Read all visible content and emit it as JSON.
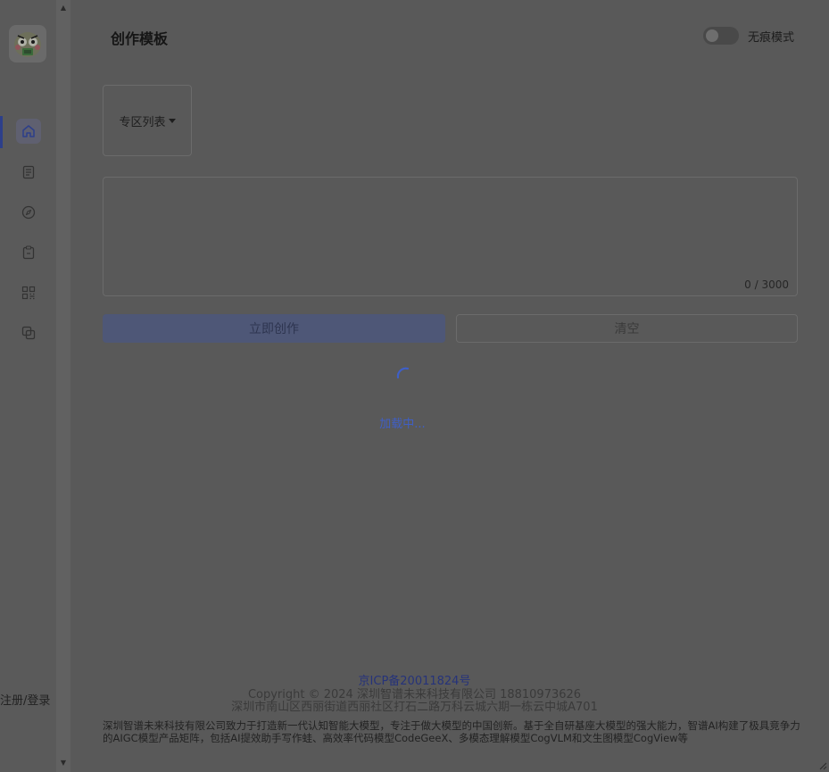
{
  "header": {
    "title": "创作模板",
    "incognito_label": "无痕模式"
  },
  "sidebar": {
    "items": [
      {
        "icon": "home-icon",
        "active": true
      },
      {
        "icon": "document-icon",
        "active": false
      },
      {
        "icon": "compass-icon",
        "active": false
      },
      {
        "icon": "clipboard-icon",
        "active": false
      },
      {
        "icon": "grid-apps-icon",
        "active": false
      },
      {
        "icon": "copy-icon",
        "active": false
      }
    ],
    "login_label": "注册/登录"
  },
  "main": {
    "zone_select_label": "专区列表",
    "textarea": {
      "value": "",
      "counter": "0 / 3000"
    },
    "create_button": "立即创作",
    "clear_button": "清空",
    "loading_text": "加载中..."
  },
  "footer": {
    "icp": "京ICP备20011824号",
    "copyright": "Copyright © 2024 深圳智谱未来科技有限公司 18810973626",
    "address": "深圳市南山区西丽街道西丽社区打石二路万科云城六期一栋云中城A701",
    "description": "深圳智谱未来科技有限公司致力于打造新一代认知智能大模型，专注于做大模型的中国创新。基于全自研基座大模型的强大能力，智谱AI构建了极具竞争力的AIGC模型产品矩阵，包括AI提效助手写作蛙、高效率代码模型CodeGeeX、多模态理解模型CogVLM和文生图模型CogView等"
  },
  "colors": {
    "overlay_bg": "#595959",
    "accent_blue": "#3f5fc6",
    "create_button_bg": "#4e5777"
  }
}
